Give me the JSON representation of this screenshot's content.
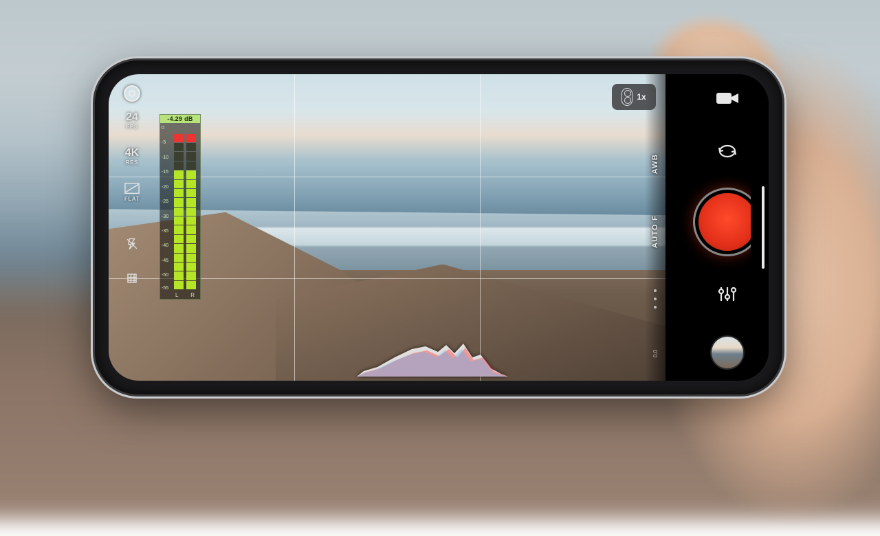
{
  "left_strip": {
    "fps": {
      "value": "24",
      "label": "FPS"
    },
    "res": {
      "value": "4K",
      "label": "RES"
    },
    "profile": {
      "label": "FLAT"
    },
    "flash_icon": "flash-off-icon",
    "grid_icon": "grid-icon"
  },
  "audio_meter": {
    "peak_db": "-4.29 dB",
    "ticks": [
      "0",
      "-5",
      "-10",
      "-15",
      "-20",
      "-25",
      "-30",
      "-35",
      "-40",
      "-45",
      "-50",
      "-55"
    ],
    "left_label": "L",
    "right_label": "R",
    "level_left_pct": 78,
    "level_right_pct": 74
  },
  "lens": {
    "zoom": "1x"
  },
  "vertical": {
    "wb_label": "AWB",
    "focus_label": "AUTO F",
    "readout": "0.0"
  },
  "right_col": {
    "mode_icon": "video-camera-icon",
    "switch_icon": "camera-switch-icon",
    "sliders_icon": "sliders-icon"
  },
  "colors": {
    "record": "#ff3b20"
  }
}
